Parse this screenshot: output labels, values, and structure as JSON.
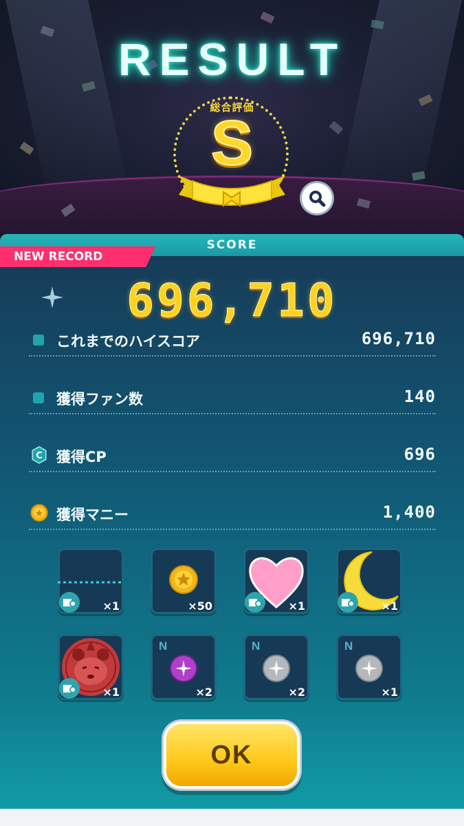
{
  "header": {
    "title": "RESULT",
    "rank_label": "総合評価",
    "rank": "S"
  },
  "score_panel": {
    "tab_label": "SCORE",
    "new_record_label": "NEW RECORD",
    "score": "696,710",
    "rows": [
      {
        "icon": "square-bullet-icon",
        "label": "これまでのハイスコア",
        "value": "696,710"
      },
      {
        "icon": "square-bullet-icon",
        "label": "獲得ファン数",
        "value": "140"
      },
      {
        "icon": "cp-coin-icon",
        "label": "獲得CP",
        "value": "696"
      },
      {
        "icon": "money-coin-icon",
        "label": "獲得マニー",
        "value": "1,400"
      }
    ]
  },
  "rewards": [
    {
      "item": "stage-background-item",
      "qty": "×1"
    },
    {
      "item": "gold-coin-item",
      "qty": "×50"
    },
    {
      "item": "heart-decoration-item",
      "qty": "×1"
    },
    {
      "item": "crescent-moon-item",
      "qty": "×1"
    },
    {
      "item": "panda-emblem-item",
      "qty": "×1"
    },
    {
      "item": "purple-orb-item",
      "badge": "N",
      "qty": "×2"
    },
    {
      "item": "silver-orb-item",
      "badge": "N",
      "qty": "×2"
    },
    {
      "item": "silver-orb-item",
      "badge": "N",
      "qty": "×1"
    }
  ],
  "ok_button": "OK",
  "colors": {
    "accent_teal": "#1fa4ad",
    "score_gold": "#ffd21e",
    "new_record_pink": "#ff2f6d",
    "ok_yellow": "#ffc81a"
  }
}
